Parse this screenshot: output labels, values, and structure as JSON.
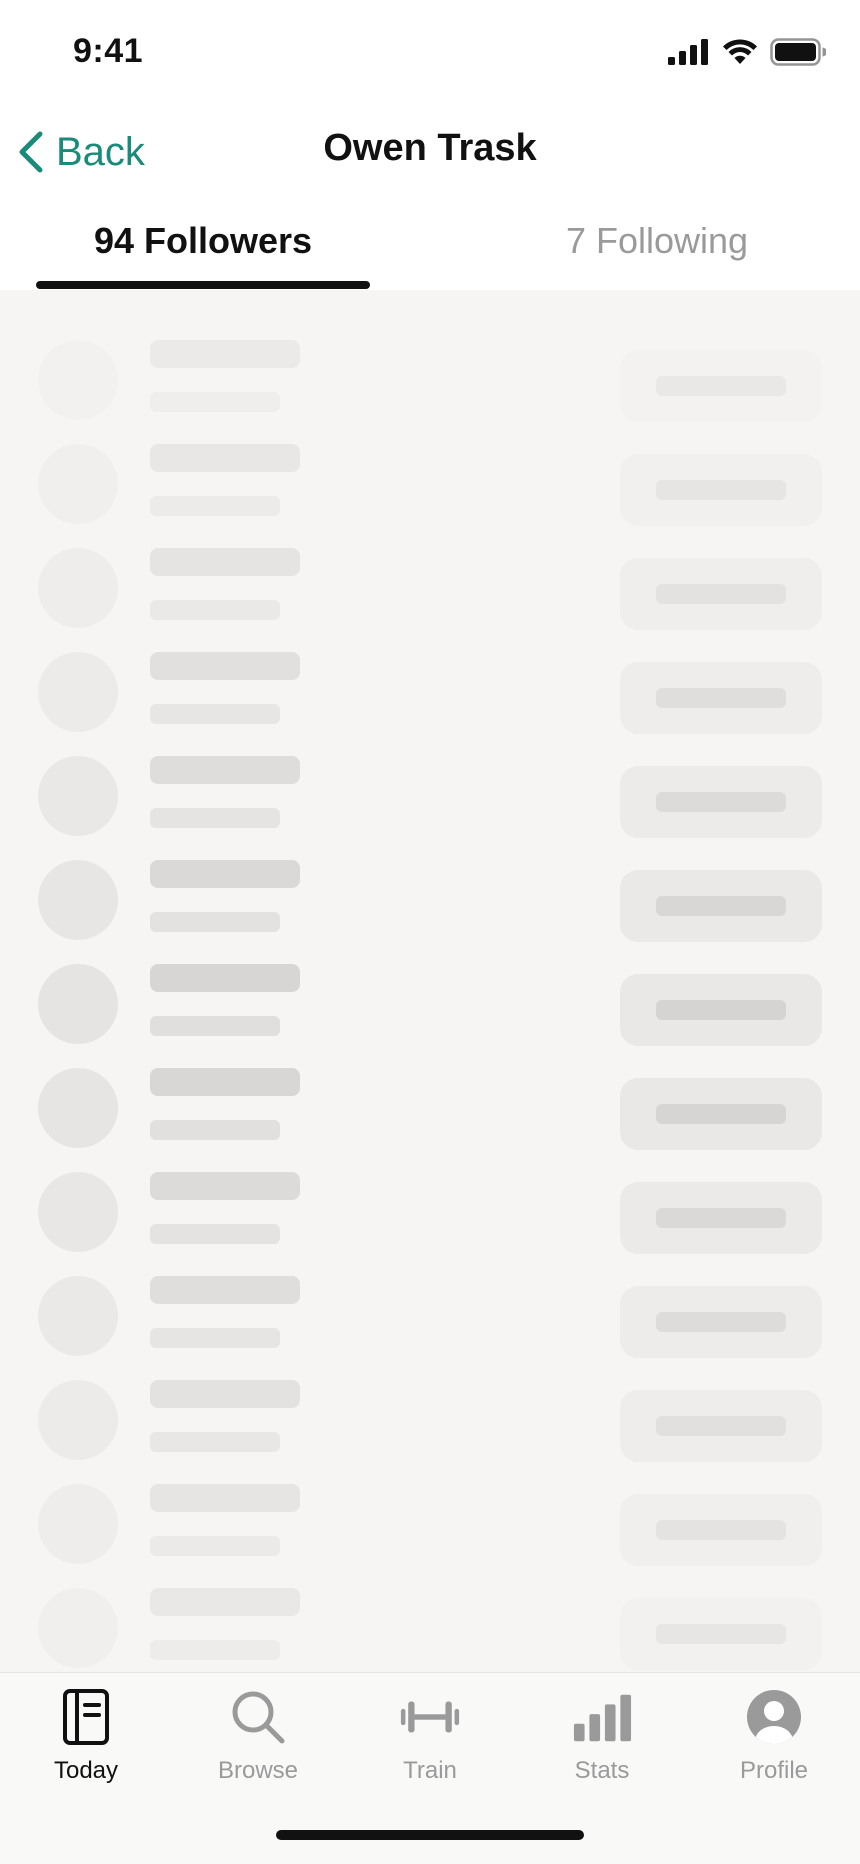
{
  "status_bar": {
    "time": "9:41"
  },
  "nav": {
    "back_label": "Back",
    "title": "Owen Trask"
  },
  "tabs": [
    {
      "label": "94 Followers",
      "active": true
    },
    {
      "label": "7 Following",
      "active": false
    }
  ],
  "skeleton_rows": 13,
  "tab_bar": {
    "items": [
      {
        "label": "Today",
        "icon": "journal-icon",
        "active": true
      },
      {
        "label": "Browse",
        "icon": "search-icon",
        "active": false
      },
      {
        "label": "Train",
        "icon": "dumbbell-icon",
        "active": false
      },
      {
        "label": "Stats",
        "icon": "bar-chart-icon",
        "active": false
      },
      {
        "label": "Profile",
        "icon": "profile-icon",
        "active": false
      }
    ]
  },
  "colors": {
    "accent": "#1a8a7a",
    "list_background": "#f6f5f3",
    "skeleton": "#e3e2e0"
  }
}
